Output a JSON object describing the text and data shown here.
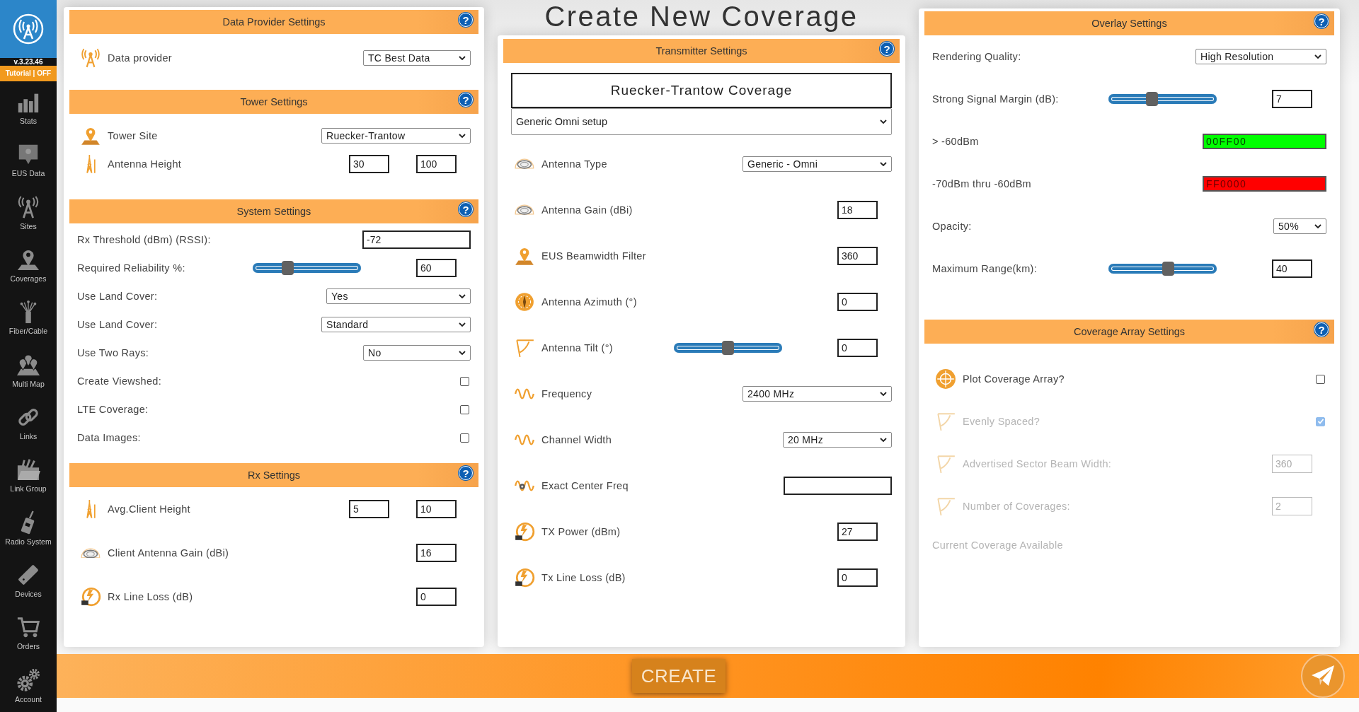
{
  "sidebar": {
    "version": "v.3.23.46",
    "tutorial": "Tutorial | OFF",
    "items": [
      {
        "label": "Stats"
      },
      {
        "label": "EUS Data"
      },
      {
        "label": "Sites"
      },
      {
        "label": "Coverages"
      },
      {
        "label": "Fiber/Cable"
      },
      {
        "label": "Multi Map"
      },
      {
        "label": "Links"
      },
      {
        "label": "Link Group"
      },
      {
        "label": "Radio System"
      },
      {
        "label": "Devices"
      },
      {
        "label": "Orders"
      },
      {
        "label": "Account"
      }
    ]
  },
  "page_title": "Create New Coverage",
  "panels": [
    {
      "sections": [
        {
          "title": "Data Provider Settings",
          "help": "?",
          "rows": [
            {
              "kind": "select",
              "label": "Data provider",
              "value": "TC Best Data"
            }
          ]
        },
        {
          "title": "Tower Settings",
          "help": "?",
          "rows": [
            {
              "kind": "select",
              "label": "Tower Site",
              "value": "Ruecker-Trantow"
            },
            {
              "kind": "pair",
              "label": "Antenna Height",
              "values": [
                "30",
                "100"
              ]
            }
          ]
        },
        {
          "title": "System Settings",
          "help": "?",
          "rows": [
            {
              "kind": "wide",
              "label": "Rx Threshold (dBm) (RSSI):",
              "value": "-72"
            },
            {
              "kind": "slider",
              "label": "Required Reliability %:",
              "level": 0.3,
              "value": "60"
            },
            {
              "kind": "select",
              "label": "Use Land Cover:",
              "value": "Yes"
            },
            {
              "kind": "select",
              "label": "Use Land Cover:",
              "value": "Standard"
            },
            {
              "kind": "select",
              "label": "Use Two Rays:",
              "value": "No"
            },
            {
              "kind": "checkbox",
              "label": "Create Viewshed:",
              "checked": false
            },
            {
              "kind": "checkbox",
              "label": "LTE Coverage:",
              "checked": false
            },
            {
              "kind": "checkbox",
              "label": "Data Images:",
              "checked": false
            }
          ]
        },
        {
          "title": "Rx Settings",
          "help": "?",
          "rows": [
            {
              "kind": "pair",
              "label": "Avg.Client Height",
              "values": [
                "5",
                "10"
              ]
            },
            {
              "kind": "input",
              "label": "Client Antenna Gain (dBi)",
              "value": "16"
            },
            {
              "kind": "input",
              "label": "Rx Line Loss (dB)",
              "value": "0"
            }
          ]
        }
      ]
    },
    {
      "sections": [
        {
          "title": "Transmitter Settings",
          "help": "?",
          "name_field": "Ruecker-Trantow Coverage",
          "preset": "Generic Omni setup",
          "rows": [
            {
              "kind": "select",
              "label": "Antenna Type",
              "value": "Generic - Omni"
            },
            {
              "kind": "input",
              "label": "Antenna Gain (dBi)",
              "value": "18"
            },
            {
              "kind": "input",
              "label": "EUS Beamwidth Filter",
              "value": "360"
            },
            {
              "kind": "input",
              "label": "Antenna Azimuth (°)",
              "value": "0"
            },
            {
              "kind": "slider",
              "label": "Antenna Tilt (°)",
              "level": 0.5,
              "value": "0"
            },
            {
              "kind": "select",
              "label": "Frequency",
              "value": "2400 MHz"
            },
            {
              "kind": "select",
              "label": "Channel Width",
              "value": "20 MHz"
            },
            {
              "kind": "wide",
              "label": "Exact Center Freq"
            },
            {
              "kind": "input",
              "label": "TX Power (dBm)",
              "value": "27"
            },
            {
              "kind": "input",
              "label": "Tx Line Loss (dB)",
              "value": "0"
            }
          ]
        }
      ]
    },
    {
      "sections": [
        {
          "title": "Overlay Settings",
          "help": "?",
          "rows": [
            {
              "kind": "select",
              "label": "Rendering Quality:",
              "value": "High Resolution"
            },
            {
              "kind": "slider",
              "label": "Strong Signal Margin (dB):",
              "level": 0.39,
              "value": "7"
            },
            {
              "kind": "color",
              "label": "> -60dBm",
              "value": "00FF00",
              "color": "#00ff00"
            },
            {
              "kind": "color",
              "label": "-70dBm thru -60dBm",
              "value": "FF0000",
              "color": "#ff0000"
            },
            {
              "kind": "select",
              "label": "Opacity:",
              "value": "50%"
            },
            {
              "kind": "slider",
              "label": "Maximum Range(km):",
              "level": 0.56,
              "value": "40"
            }
          ]
        },
        {
          "title": "Coverage Array Settings",
          "help": "?",
          "rows": [
            {
              "kind": "checkbox",
              "label": "Plot Coverage Array?",
              "checked": false,
              "disabled": false
            },
            {
              "kind": "checkbox",
              "label": "Evenly Spaced?",
              "checked": true,
              "disabled": true
            },
            {
              "kind": "input",
              "label": "Advertised Sector Beam Width:",
              "value": "360",
              "disabled": true
            },
            {
              "kind": "input",
              "label": "Number of Coverages:",
              "value": "2",
              "disabled": true
            },
            {
              "kind": "note",
              "label": "Current Coverage Available",
              "disabled": true
            }
          ]
        }
      ]
    }
  ],
  "footer": {
    "button": "CREATE"
  }
}
